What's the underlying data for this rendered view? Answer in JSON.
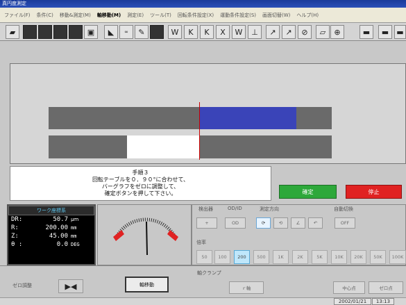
{
  "window": {
    "title": "真円度測定"
  },
  "menu": [
    "ファイル(F)",
    "条件(C)",
    "移動&測定(M)",
    "軸移動(M)",
    "測定(E)",
    "ツール(T)",
    "回転条件設定(X)",
    "運動条件設定(S)",
    "画面切替(W)",
    "ヘルプ(H)"
  ],
  "message": {
    "line1": "手順３",
    "line2": "回転テーブルを０．９０°に合わせて、",
    "line3": "バーグラフをゼロに調整して、",
    "line4": "確定ボタンを押して下さい。"
  },
  "buttons": {
    "confirm": "確定",
    "stop": "停止",
    "axis_move": "軸移動",
    "r_axis": "ｒ軸",
    "center_point": "中心点",
    "zero_point": "ゼロ点"
  },
  "coords": {
    "header": "ワーク座標系",
    "rows": [
      {
        "label": "DR:",
        "value": "50.7",
        "unit": "μｍ"
      },
      {
        "label": "R:",
        "value": "200.00",
        "unit": "mm"
      },
      {
        "label": "Z:",
        "value": "45.00",
        "unit": "mm"
      },
      {
        "label": "θ :",
        "value": "0.0",
        "unit": "DEG"
      }
    ]
  },
  "zero_adjust": {
    "label": "ゼロ調整"
  },
  "groups": {
    "probe": "検出器",
    "od_id": "OD/ID",
    "direction": "測定方向",
    "auto_range": "自動切換",
    "magnification": "倍率",
    "axis_clamp": "軸クランプ"
  },
  "controls": {
    "plus": "+",
    "od": "OD",
    "off": "OFF"
  },
  "magnification": [
    "50",
    "100",
    "200",
    "500",
    "1K",
    "2K",
    "5K",
    "10K",
    "20K",
    "50K",
    "100K"
  ],
  "selected_magnification": "200",
  "status": {
    "date": "2002/01/21",
    "time": "13:13"
  },
  "bargraph": {
    "upper_fill_fraction": 0.34,
    "lower_fill_fraction": 0.19
  },
  "colors": {
    "blue_fill": "#3a44b8",
    "marker": "#cc0000",
    "confirm": "#2da83a",
    "stop": "#e02222",
    "coord_header": "#5fc8f0"
  }
}
